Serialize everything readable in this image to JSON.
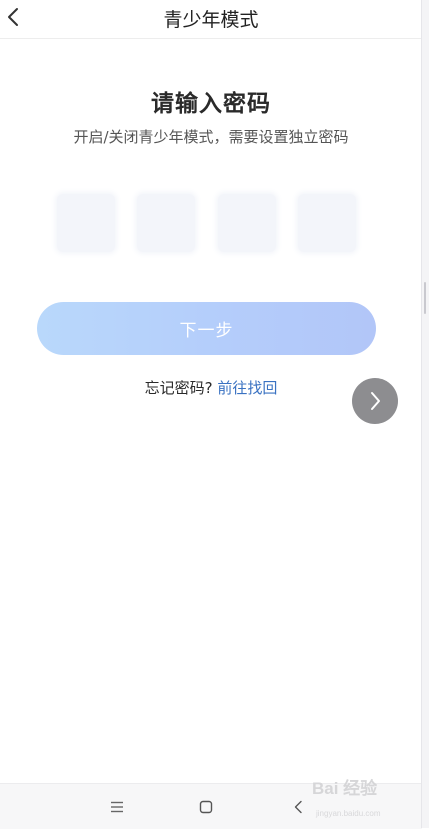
{
  "header": {
    "title": "青少年模式"
  },
  "main": {
    "heading": "请输入密码",
    "subtitle": "开启/关闭青少年模式，需要设置独立密码",
    "pin_length": 4,
    "pin_values": [
      "",
      "",
      "",
      ""
    ],
    "next_label": "下一步",
    "forgot_text": "忘记密码?",
    "forgot_link": "前往找回"
  },
  "floating": {
    "icon": "chevron-right-icon"
  },
  "nav": {
    "items": [
      "menu-icon",
      "home-square-icon",
      "back-chevron-icon"
    ]
  },
  "watermark": {
    "brand": "Bai 经验",
    "url": "jingyan.baidu.com"
  },
  "colors": {
    "accent_link": "#3a72c2",
    "button_gradient_start": "#b9d8fb",
    "button_gradient_end": "#b2c6f8",
    "pin_box": "#f3f5fa",
    "float_button": "#8d8d90"
  }
}
